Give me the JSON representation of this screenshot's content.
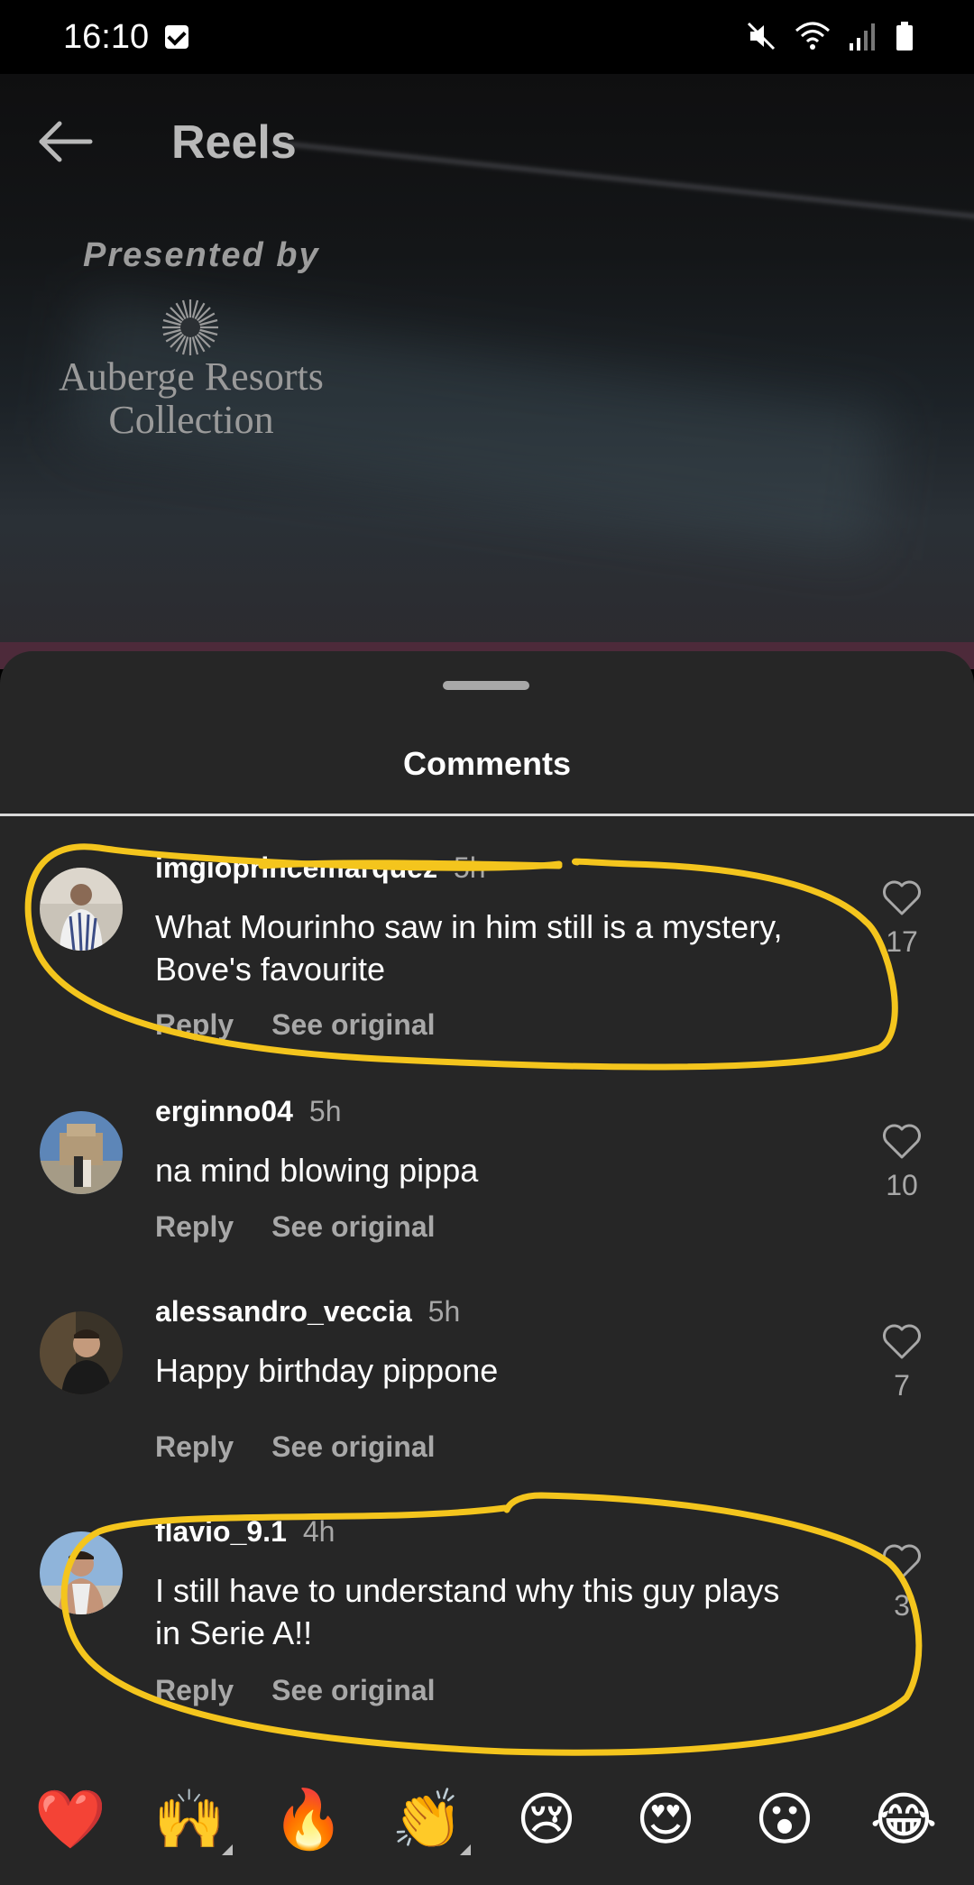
{
  "status_bar": {
    "time": "16:10"
  },
  "header": {
    "title": "Reels"
  },
  "ad": {
    "presented_by": "Presented by",
    "brand_line1": "Auberge Resorts",
    "brand_line2": "Collection"
  },
  "sheet": {
    "title": "Comments"
  },
  "comments": [
    {
      "username": "imgioprincemarquez",
      "time": "5h",
      "text": "What Mourinho saw in him still is a mystery, Bove's favourite",
      "likes": "17",
      "reply": "Reply",
      "see_original": "See original"
    },
    {
      "username": "erginno04",
      "time": "5h",
      "text": "na mind blowing pippa",
      "likes": "10",
      "reply": "Reply",
      "see_original": "See original"
    },
    {
      "username": "alessandro_veccia",
      "time": "5h",
      "text": "Happy birthday pippone",
      "likes": "7",
      "reply": "Reply",
      "see_original": "See original"
    },
    {
      "username": "flavio_9.1",
      "time": "4h",
      "text": "I still have to understand why this guy plays in Serie A!!",
      "likes": "3",
      "reply": "Reply",
      "see_original": "See original"
    }
  ],
  "emoji_bar": [
    "❤️",
    "🙌",
    "🔥",
    "👏",
    "😢",
    "😍",
    "😮",
    "😂"
  ],
  "colors": {
    "highlight": "#f4c51d",
    "sheet_bg": "#262626"
  }
}
